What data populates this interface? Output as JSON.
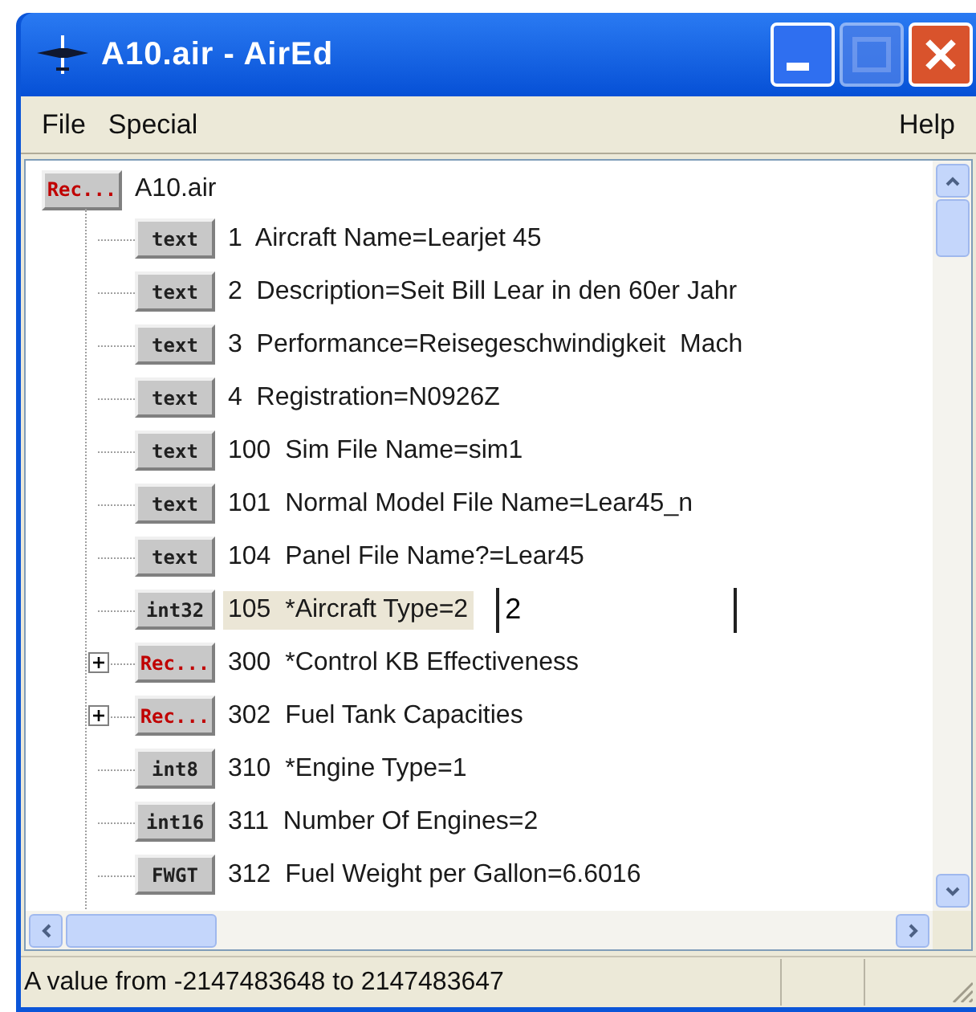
{
  "window": {
    "title": "A10.air - AirEd"
  },
  "menu": {
    "left": [
      {
        "label": "File"
      },
      {
        "label": "Special"
      }
    ],
    "right": [
      {
        "label": "Help"
      }
    ]
  },
  "tree": {
    "root": {
      "kind": "record",
      "badge": "Rec...",
      "label": "A10.air",
      "selected": false
    },
    "children": [
      {
        "kind": "text",
        "badge": "text",
        "number": "1",
        "label": "Aircraft Name=Learjet 45",
        "selected": false
      },
      {
        "kind": "text",
        "badge": "text",
        "number": "2",
        "label": "Description=Seit Bill Lear in den 60er Jahr",
        "selected": false
      },
      {
        "kind": "text",
        "badge": "text",
        "number": "3",
        "label": "Performance=Reisegeschwindigkeit  Mach",
        "selected": false
      },
      {
        "kind": "text",
        "badge": "text",
        "number": "4",
        "label": "Registration=N0926Z",
        "selected": false
      },
      {
        "kind": "text",
        "badge": "text",
        "number": "100",
        "label": "Sim File Name=sim1",
        "selected": false
      },
      {
        "kind": "text",
        "badge": "text",
        "number": "101",
        "label": "Normal Model File Name=Lear45_n",
        "selected": false
      },
      {
        "kind": "text",
        "badge": "text",
        "number": "104",
        "label": "Panel File Name?=Lear45",
        "selected": false
      },
      {
        "kind": "number",
        "badge": "int32",
        "number": "105",
        "label": "*Aircraft Type=2",
        "selected": true,
        "edit_value": "2"
      },
      {
        "kind": "record",
        "badge": "Rec...",
        "number": "300",
        "label": "*Control KB Effectiveness",
        "selected": false,
        "expanded": false
      },
      {
        "kind": "record",
        "badge": "Rec...",
        "number": "302",
        "label": "Fuel Tank Capacities",
        "selected": false,
        "expanded": false
      },
      {
        "kind": "number",
        "badge": "int8",
        "number": "310",
        "label": "*Engine Type=1",
        "selected": false
      },
      {
        "kind": "number",
        "badge": "int16",
        "number": "311",
        "label": "Number Of Engines=2",
        "selected": false
      },
      {
        "kind": "number",
        "badge": "FWGT",
        "number": "312",
        "label": "Fuel Weight per Gallon=6.6016",
        "selected": false
      }
    ]
  },
  "status_bar": {
    "message": "A value from -2147483648 to 2147483647"
  }
}
